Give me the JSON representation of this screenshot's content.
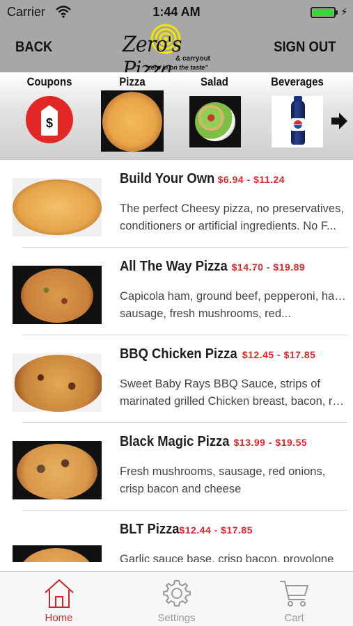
{
  "status_bar": {
    "carrier": "Carrier",
    "time": "1:44 AM",
    "icons": [
      "wifi-icon",
      "battery-icon",
      "charging-bolt-icon"
    ]
  },
  "nav": {
    "back_label": "BACK",
    "signout_label": "SIGN OUT",
    "logo": {
      "name": "Zero's Pizza",
      "sub": "& carryout",
      "tagline": "\"zero in on the taste\""
    }
  },
  "categories": [
    {
      "label": "Coupons",
      "icon": "coupon-tag-icon"
    },
    {
      "label": "Pizza",
      "icon": "pizza-image"
    },
    {
      "label": "Salad",
      "icon": "salad-image"
    },
    {
      "label": "Beverages",
      "icon": "soda-bottle-image"
    }
  ],
  "menu_items": [
    {
      "name": "Build Your Own",
      "price": "$6.94 - $11.24",
      "desc_line1": "The perfect Cheesy pizza, no preservatives,",
      "desc_line2": "conditioners or artificial ingredients. No F..."
    },
    {
      "name": "All The Way Pizza",
      "price": "$14.70 - $19.89",
      "desc_line1": "Capicola ham, ground beef, pepperoni, ham,",
      "desc_line2": "sausage, fresh mushrooms, red..."
    },
    {
      "name": "BBQ Chicken Pizza",
      "price": "$12.45 - $17.85",
      "desc_line1": "Sweet Baby Rays BBQ Sauce, strips of",
      "desc_line2": "marinated grilled Chicken  breast, bacon, re..."
    },
    {
      "name": "Black Magic Pizza",
      "price": "$13.99 - $19.55",
      "desc_line1": "Fresh mushrooms, sausage, red onions,",
      "desc_line2": "crisp bacon and cheese"
    },
    {
      "name": "BLT Pizza",
      "price": "$12.44 - $17.85",
      "desc_line1": "Garlic sauce base, crisp bacon, provolone",
      "desc_line2": ""
    }
  ],
  "tabs": [
    {
      "label": "Home",
      "icon": "home-icon",
      "active": true
    },
    {
      "label": "Settings",
      "icon": "gear-icon",
      "active": false
    },
    {
      "label": "Cart",
      "icon": "cart-icon",
      "active": false
    }
  ],
  "colors": {
    "bar_gray": "#a7a7a7",
    "price_red": "#e0262b",
    "active_tab": "#c9262b",
    "inactive_tab": "#999999",
    "logo_yellow": "#f2e600"
  }
}
